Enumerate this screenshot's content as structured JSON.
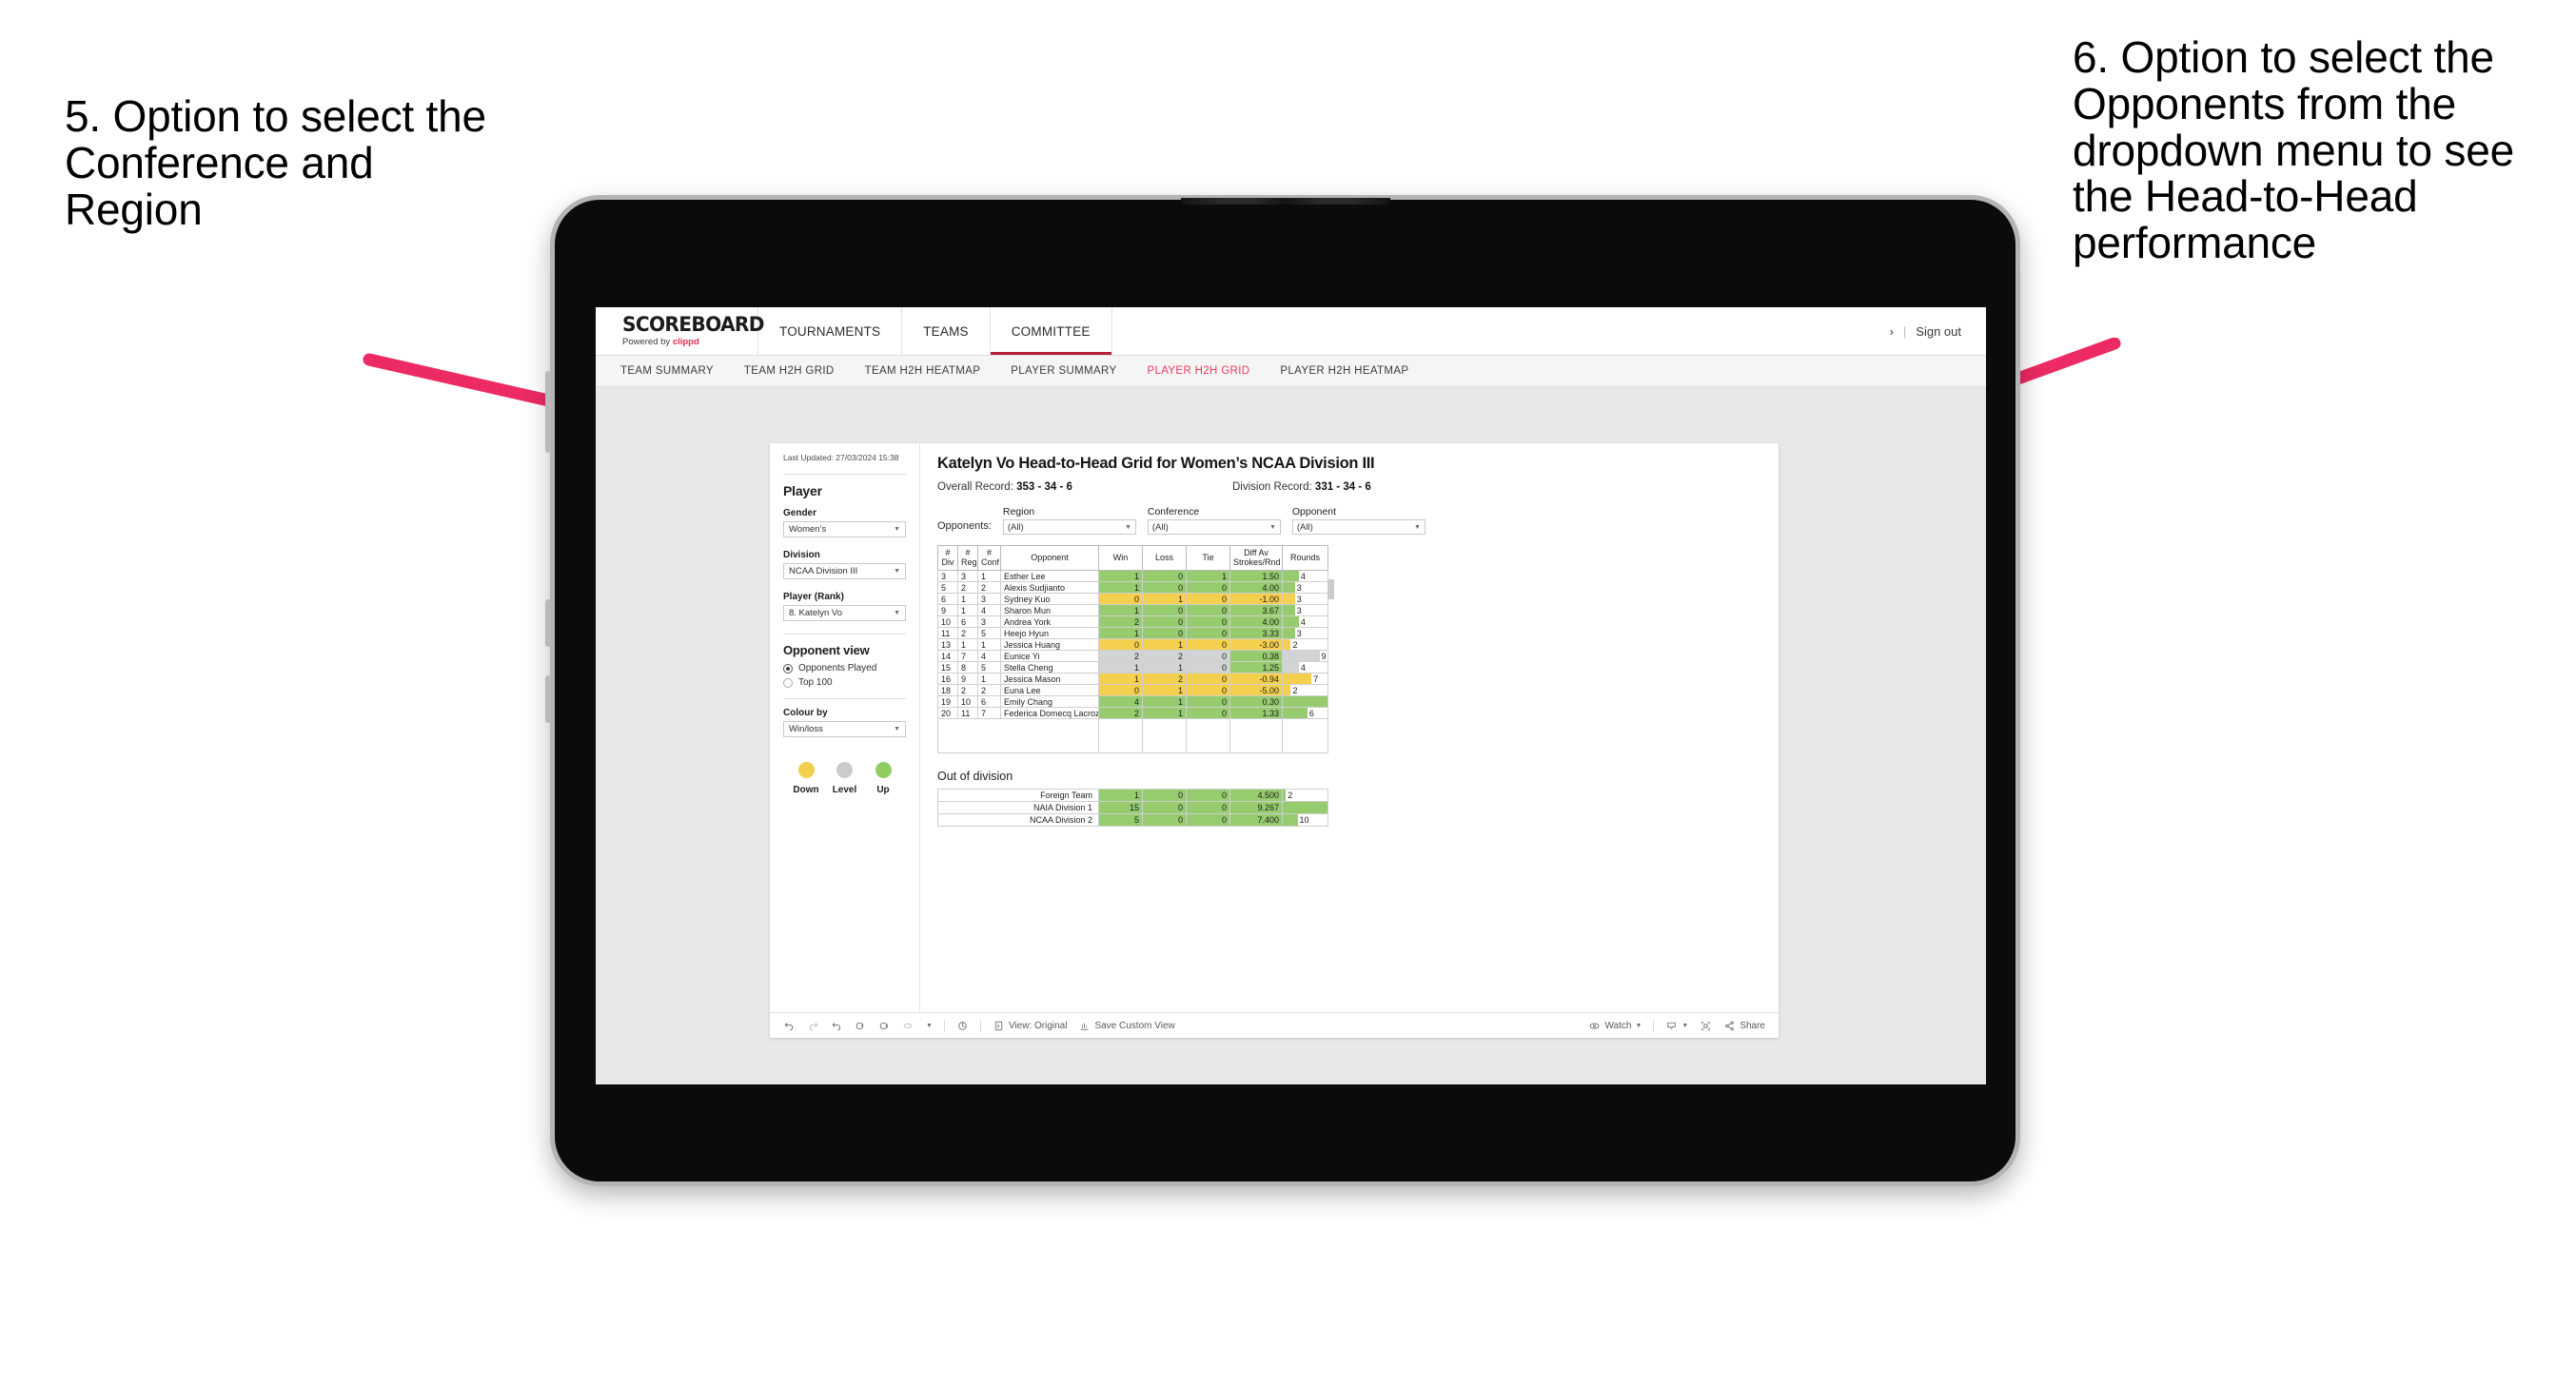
{
  "annotations": {
    "left": "5. Option to select the Conference and Region",
    "right": "6. Option to select the Opponents from the dropdown menu to see the Head-to-Head performance"
  },
  "topnav": {
    "brand_name": "SCOREBOARD",
    "brand_sub_prefix": "Powered by ",
    "brand_sub_accent": "clippd",
    "items": [
      {
        "label": "TOURNAMENTS",
        "active": false
      },
      {
        "label": "TEAMS",
        "active": false
      },
      {
        "label": "COMMITTEE",
        "active": true
      }
    ],
    "chevron": "›",
    "separator": "|",
    "sign_out": "Sign out"
  },
  "subnav": {
    "items": [
      {
        "label": "TEAM SUMMARY",
        "active": false
      },
      {
        "label": "TEAM H2H GRID",
        "active": false
      },
      {
        "label": "TEAM H2H HEATMAP",
        "active": false
      },
      {
        "label": "PLAYER SUMMARY",
        "active": false
      },
      {
        "label": "PLAYER H2H GRID",
        "active": true
      },
      {
        "label": "PLAYER H2H HEATMAP",
        "active": false
      }
    ]
  },
  "panel": {
    "last_updated": "Last Updated: 27/03/2024 15:38",
    "player_title": "Player",
    "gender": {
      "label": "Gender",
      "value": "Women’s"
    },
    "division": {
      "label": "Division",
      "value": "NCAA Division III"
    },
    "player_rank": {
      "label": "Player (Rank)",
      "value": "8. Katelyn Vo"
    },
    "opponent_view": {
      "title": "Opponent view",
      "options": [
        {
          "label": "Opponents Played",
          "selected": true
        },
        {
          "label": "Top 100",
          "selected": false
        }
      ]
    },
    "colour_by": {
      "label": "Colour by",
      "value": "Win/loss"
    },
    "legend": [
      {
        "label": "Down",
        "color": "#f2cf4d"
      },
      {
        "label": "Level",
        "color": "#c9cbcd"
      },
      {
        "label": "Up",
        "color": "#8fcc62"
      }
    ]
  },
  "view": {
    "title": "Katelyn Vo Head-to-Head Grid for Women’s NCAA Division III",
    "overall_record_label": "Overall Record: ",
    "overall_record_value": "353 - 34 - 6",
    "division_record_label": "Division Record: ",
    "division_record_value": "331 - 34 - 6",
    "opponents_label": "Opponents:",
    "filters": [
      {
        "label": "Region",
        "value": "(All)"
      },
      {
        "label": "Conference",
        "value": "(All)"
      },
      {
        "label": "Opponent",
        "value": "(All)"
      }
    ]
  },
  "chart_data": {
    "type": "table",
    "title": "Katelyn Vo Head-to-Head Grid for Women’s NCAA Division III",
    "columns": [
      "# Div",
      "# Reg",
      "# Conf",
      "Opponent",
      "Win",
      "Loss",
      "Tie",
      "Diff Av Strokes/Rnd",
      "Rounds"
    ],
    "column_headers_multiline": [
      [
        "#",
        "Div"
      ],
      [
        "#",
        "Reg"
      ],
      [
        "#",
        "Conf"
      ],
      [
        "Opponent"
      ],
      [
        "Win"
      ],
      [
        "Loss"
      ],
      [
        "Tie"
      ],
      [
        "Diff Av",
        "Strokes/Rnd"
      ],
      [
        "Rounds"
      ]
    ],
    "rounds_max": 11,
    "rows": [
      {
        "div": "3",
        "reg": "3",
        "conf": "1",
        "opponent": "Esther Lee",
        "win": "1",
        "loss": "0",
        "tie": "1",
        "diff": "1.50",
        "rounds": 4,
        "status": "up"
      },
      {
        "div": "5",
        "reg": "2",
        "conf": "2",
        "opponent": "Alexis Sudjianto",
        "win": "1",
        "loss": "0",
        "tie": "0",
        "diff": "4.00",
        "rounds": 3,
        "status": "up"
      },
      {
        "div": "6",
        "reg": "1",
        "conf": "3",
        "opponent": "Sydney Kuo",
        "win": "0",
        "loss": "1",
        "tie": "0",
        "diff": "-1.00",
        "rounds": 3,
        "status": "down"
      },
      {
        "div": "9",
        "reg": "1",
        "conf": "4",
        "opponent": "Sharon Mun",
        "win": "1",
        "loss": "0",
        "tie": "0",
        "diff": "3.67",
        "rounds": 3,
        "status": "up"
      },
      {
        "div": "10",
        "reg": "6",
        "conf": "3",
        "opponent": "Andrea York",
        "win": "2",
        "loss": "0",
        "tie": "0",
        "diff": "4.00",
        "rounds": 4,
        "status": "up"
      },
      {
        "div": "11",
        "reg": "2",
        "conf": "5",
        "opponent": "Heejo Hyun",
        "win": "1",
        "loss": "0",
        "tie": "0",
        "diff": "3.33",
        "rounds": 3,
        "status": "up"
      },
      {
        "div": "13",
        "reg": "1",
        "conf": "1",
        "opponent": "Jessica Huang",
        "win": "0",
        "loss": "1",
        "tie": "0",
        "diff": "-3.00",
        "rounds": 2,
        "status": "down"
      },
      {
        "div": "14",
        "reg": "7",
        "conf": "4",
        "opponent": "Eunice Yi",
        "win": "2",
        "loss": "2",
        "tie": "0",
        "diff": "0.38",
        "rounds": 9,
        "status": "level"
      },
      {
        "div": "15",
        "reg": "8",
        "conf": "5",
        "opponent": "Stella Cheng",
        "win": "1",
        "loss": "1",
        "tie": "0",
        "diff": "1.25",
        "rounds": 4,
        "status": "level"
      },
      {
        "div": "16",
        "reg": "9",
        "conf": "1",
        "opponent": "Jessica Mason",
        "win": "1",
        "loss": "2",
        "tie": "0",
        "diff": "-0.94",
        "rounds": 7,
        "status": "down"
      },
      {
        "div": "18",
        "reg": "2",
        "conf": "2",
        "opponent": "Euna Lee",
        "win": "0",
        "loss": "1",
        "tie": "0",
        "diff": "-5.00",
        "rounds": 2,
        "status": "down"
      },
      {
        "div": "19",
        "reg": "10",
        "conf": "6",
        "opponent": "Emily Chang",
        "win": "4",
        "loss": "1",
        "tie": "0",
        "diff": "0.30",
        "rounds": 11,
        "status": "up"
      },
      {
        "div": "20",
        "reg": "11",
        "conf": "7",
        "opponent": "Federica Domecq Lacroze",
        "win": "2",
        "loss": "1",
        "tie": "0",
        "diff": "1.33",
        "rounds": 6,
        "status": "up"
      }
    ],
    "out_of_division": {
      "title": "Out of division",
      "rounds_max": 30,
      "rows": [
        {
          "name": "Foreign Team",
          "win": "1",
          "loss": "0",
          "tie": "0",
          "diff": "4.500",
          "rounds": 2,
          "status": "up"
        },
        {
          "name": "NAIA Division 1",
          "win": "15",
          "loss": "0",
          "tie": "0",
          "diff": "9.267",
          "rounds": 30,
          "status": "up"
        },
        {
          "name": "NCAA Division 2",
          "win": "5",
          "loss": "0",
          "tie": "0",
          "diff": "7.400",
          "rounds": 10,
          "status": "up"
        }
      ]
    }
  },
  "toolbar": {
    "undo": "undo-icon",
    "redo": "redo-icon",
    "revert": "revert-icon",
    "refresh": "refresh-icon",
    "pause": "pause-icon",
    "highlight": "highlight-icon",
    "show_me": "show-me-icon",
    "view_label": "View: Original",
    "save_label": "Save Custom View",
    "watch_label": "Watch",
    "share_label": "Share",
    "download": "download-icon",
    "fullscreen": "fullscreen-icon"
  },
  "colors": {
    "accent": "#ea3b5c",
    "active_tab_underline": "#b3203c",
    "up": "#96cc6e",
    "down": "#f5d04e",
    "level": "#d2d3d4",
    "arrow": "#ec2a63"
  }
}
